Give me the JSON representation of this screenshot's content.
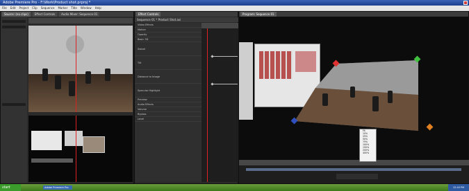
{
  "window": {
    "title": "Adobe Premiere Pro - F:\\Work\\Product shot.prproj *"
  },
  "menu": [
    "File",
    "Edit",
    "Project",
    "Clip",
    "Sequence",
    "Marker",
    "Title",
    "Window",
    "Help"
  ],
  "panels": {
    "source": {
      "tabs": [
        "Source: (no clips)",
        "Effect Controls",
        "Audio Mixer: Sequence 01"
      ]
    },
    "effects": {
      "tabs": [
        "Effect Controls"
      ],
      "header": "Sequence 01 * Product Shot.avi",
      "rows": [
        "Video Effects",
        "Motion",
        "Opacity",
        "Basic 3D",
        "Swivel",
        "Tilt",
        "Distance to Image",
        "Specular Highlight",
        "Preview",
        "Audio Effects",
        "Volume",
        "Bypass",
        "Level"
      ]
    },
    "program": {
      "tabs": [
        "Program: Sequence 01"
      ]
    }
  },
  "zoom_menu": [
    "Fit",
    "10%",
    "25%",
    "50%",
    "75%",
    "100%",
    "150%",
    "200%",
    "400%"
  ],
  "taskbar": {
    "start": "start",
    "task": "Adobe Premiere Pro",
    "clock": "12:45 PM"
  },
  "colors": {
    "accent": "#3b63b7",
    "handle_red": "#e03030",
    "handle_green": "#40c040",
    "handle_blue": "#3050c0",
    "handle_orange": "#e08020"
  }
}
